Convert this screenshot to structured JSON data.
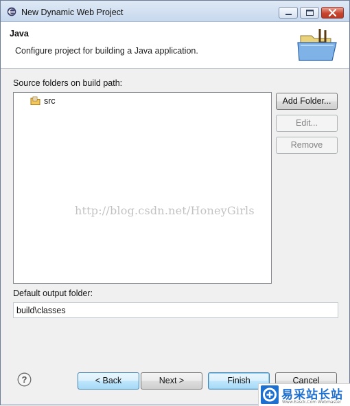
{
  "window": {
    "title": "New Dynamic Web Project",
    "controls": {
      "minimize_icon": "minimize-icon",
      "maximize_icon": "maximize-icon",
      "close_icon": "close-icon"
    }
  },
  "banner": {
    "title": "Java",
    "description": "Configure project for building a Java application.",
    "icon": "java-project-folder-icon"
  },
  "source_folders": {
    "label": "Source folders on build path:",
    "items": [
      {
        "label": "src",
        "icon": "source-folder-icon"
      }
    ],
    "buttons": {
      "add_folder": "Add Folder...",
      "edit": "Edit...",
      "remove": "Remove"
    }
  },
  "output": {
    "label": "Default output folder:",
    "value": "build\\classes"
  },
  "watermark": "http://blog.csdn.net/HoneyGirls",
  "footer": {
    "help_icon": "help-icon",
    "back": "< Back",
    "next": "Next >",
    "finish": "Finish",
    "cancel": "Cancel"
  },
  "corner_logo": {
    "text": "易采站长站",
    "subtext": "Www.Easck.Com  Webmaster"
  },
  "colors": {
    "titlebar": "#c7d8ee",
    "button_focus": "#3c7fb1",
    "logo_blue": "#1d6fd0"
  }
}
